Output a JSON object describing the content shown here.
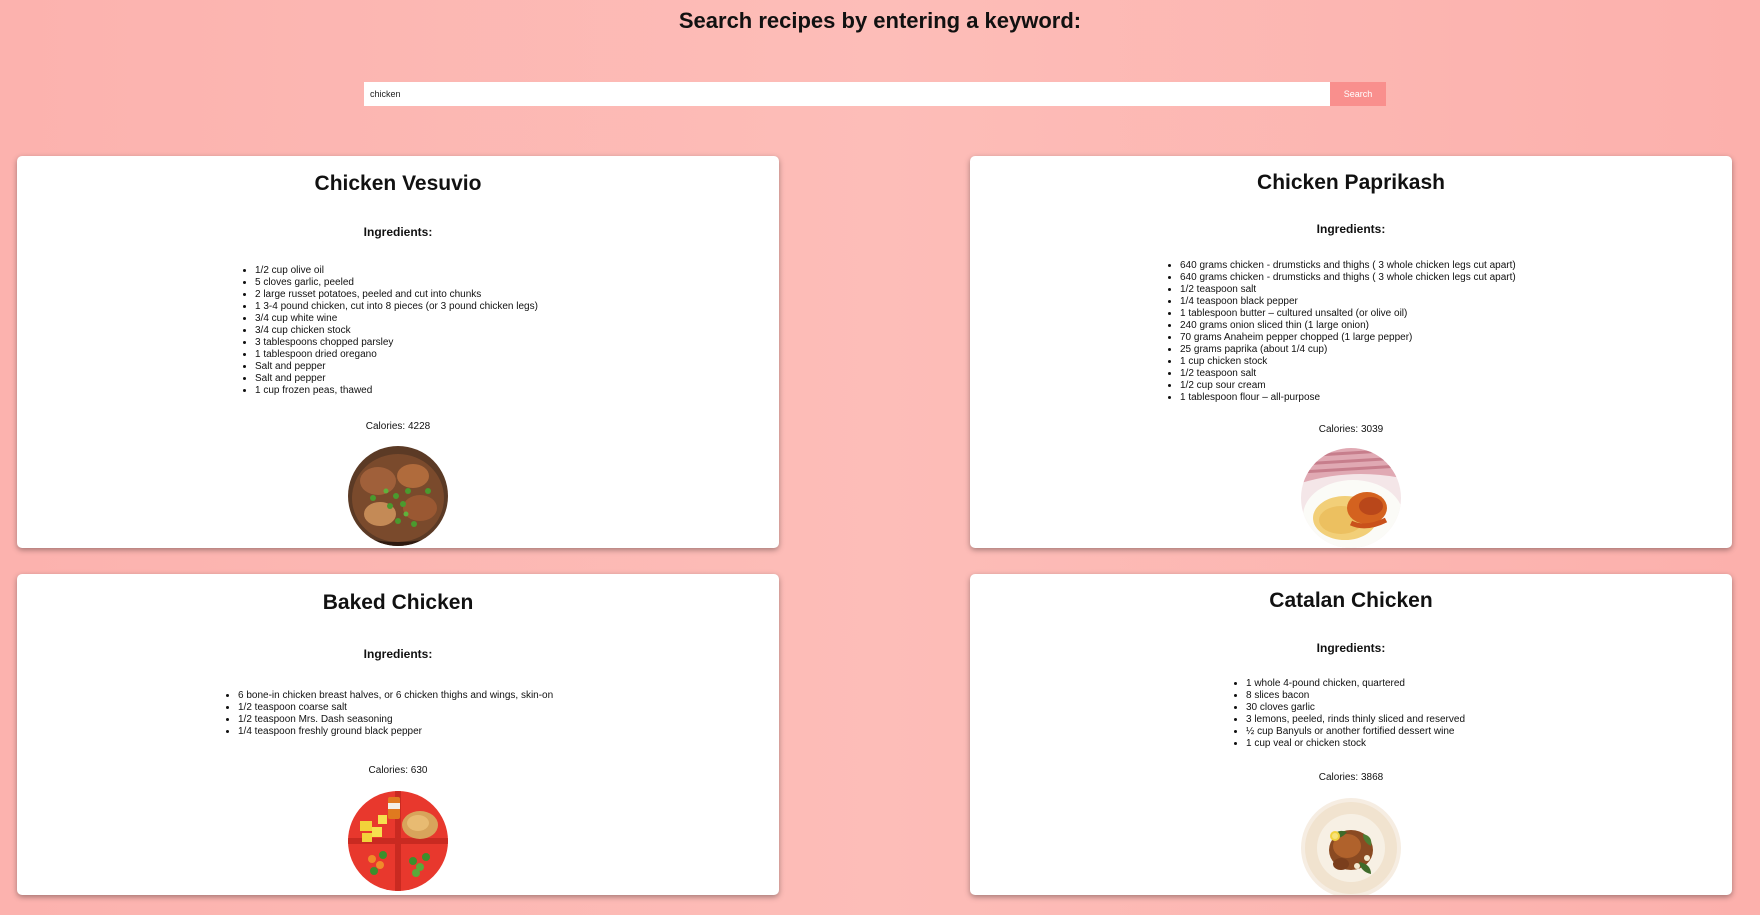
{
  "header": {
    "title": "Search recipes by entering a keyword:"
  },
  "search": {
    "value": "chicken",
    "button_label": "Search"
  },
  "recipes": [
    {
      "title": "Chicken Vesuvio",
      "ingredients_heading": "Ingredients:",
      "ingredients": [
        "1/2 cup olive oil",
        "5 cloves garlic, peeled",
        "2 large russet potatoes, peeled and cut into chunks",
        "1 3-4 pound chicken, cut into 8 pieces (or 3 pound chicken legs)",
        "3/4 cup white wine",
        "3/4 cup chicken stock",
        "3 tablespoons chopped parsley",
        "1 tablespoon dried oregano",
        "Salt and pepper",
        "Salt and pepper",
        "1 cup frozen peas, thawed"
      ],
      "calories": "Calories: 4228",
      "image_icon": "chicken-vesuvio-photo"
    },
    {
      "title": "Chicken Paprikash",
      "ingredients_heading": "Ingredients:",
      "ingredients": [
        "640 grams chicken - drumsticks and thighs ( 3 whole chicken legs cut apart)",
        "640 grams chicken - drumsticks and thighs ( 3 whole chicken legs cut apart)",
        "1/2 teaspoon salt",
        "1/4 teaspoon black pepper",
        "1 tablespoon butter – cultured unsalted (or olive oil)",
        "240 grams onion sliced thin (1 large onion)",
        "70 grams Anaheim pepper chopped (1 large pepper)",
        "25 grams paprika (about 1/4 cup)",
        "1 cup chicken stock",
        "1/2 teaspoon salt",
        "1/2 cup sour cream",
        "1 tablespoon flour – all-purpose"
      ],
      "calories": "Calories: 3039",
      "image_icon": "chicken-paprikash-photo"
    },
    {
      "title": "Baked Chicken",
      "ingredients_heading": "Ingredients:",
      "ingredients": [
        "6 bone-in chicken breast halves, or 6 chicken thighs and wings, skin-on",
        "1/2 teaspoon coarse salt",
        "1/2 teaspoon Mrs. Dash seasoning",
        "1/4 teaspoon freshly ground black pepper"
      ],
      "calories": "Calories: 630",
      "image_icon": "baked-chicken-photo"
    },
    {
      "title": "Catalan Chicken",
      "ingredients_heading": "Ingredients:",
      "ingredients": [
        "1 whole 4-pound chicken, quartered",
        "8 slices bacon",
        "30 cloves garlic",
        "3 lemons, peeled, rinds thinly sliced and reserved",
        "½ cup Banyuls or another fortified dessert wine",
        "1 cup veal or chicken stock"
      ],
      "calories": "Calories: 3868",
      "image_icon": "catalan-chicken-photo"
    }
  ],
  "colors": {
    "background_start": "#fcb2ae",
    "background_mid": "#fdbdb8",
    "search_button": "#f98f8d",
    "card": "#ffffff"
  }
}
